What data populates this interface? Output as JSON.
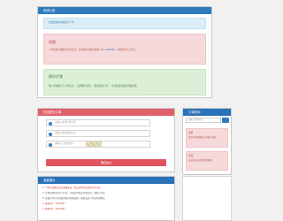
{
  "notice": {
    "title": "系统公告",
    "info": "欢迎使用本系统进行下单",
    "warn_title": "提醒",
    "warn_text_1": "下单前请仔细核对订单信息，如有疑问请联系客服 QQ: ",
    "warn_qq": "1034687",
    "warn_text_2": "，处理时间为工作日",
    "ok_title": "操作步骤",
    "ok_text": "输入查询账号与下单信息 → 选择服务项目 → 确认提交订单 → 等待处理完成后查看结果"
  },
  "order": {
    "title": "在线提交订单",
    "field1": "请输入您的订单号码",
    "field2": "请输入您的联系方式",
    "field3": "请输入下方验证码",
    "submit": "确定提交"
  },
  "side": {
    "title": "订单查询",
    "search_placeholder": "请输入查询内容",
    "box1_title": "提醒",
    "box1_text": "查询订单前请确认号码填写正确",
    "box2_title": "处理",
    "box2_text": "如长时间未处理请联系客服"
  },
  "tips": {
    "title": "温馨提示",
    "t1": "1. 下单前请确认信息准确无误，提交后将无法修改订单内容",
    "t2": "2. 订单处理时间为工作日，节假日可能会有所延迟，请耐心等待",
    "t3": "3. 如遇订单异常请及时联系客服处理，客服会第一时间为您解决",
    "t4": "4. 客服QQ：1034687",
    "t5": "5. 客服QQ：2034687"
  },
  "colors": {
    "primary": "#2f7bbf",
    "danger": "#e25560",
    "background": "#f1f1f1"
  }
}
